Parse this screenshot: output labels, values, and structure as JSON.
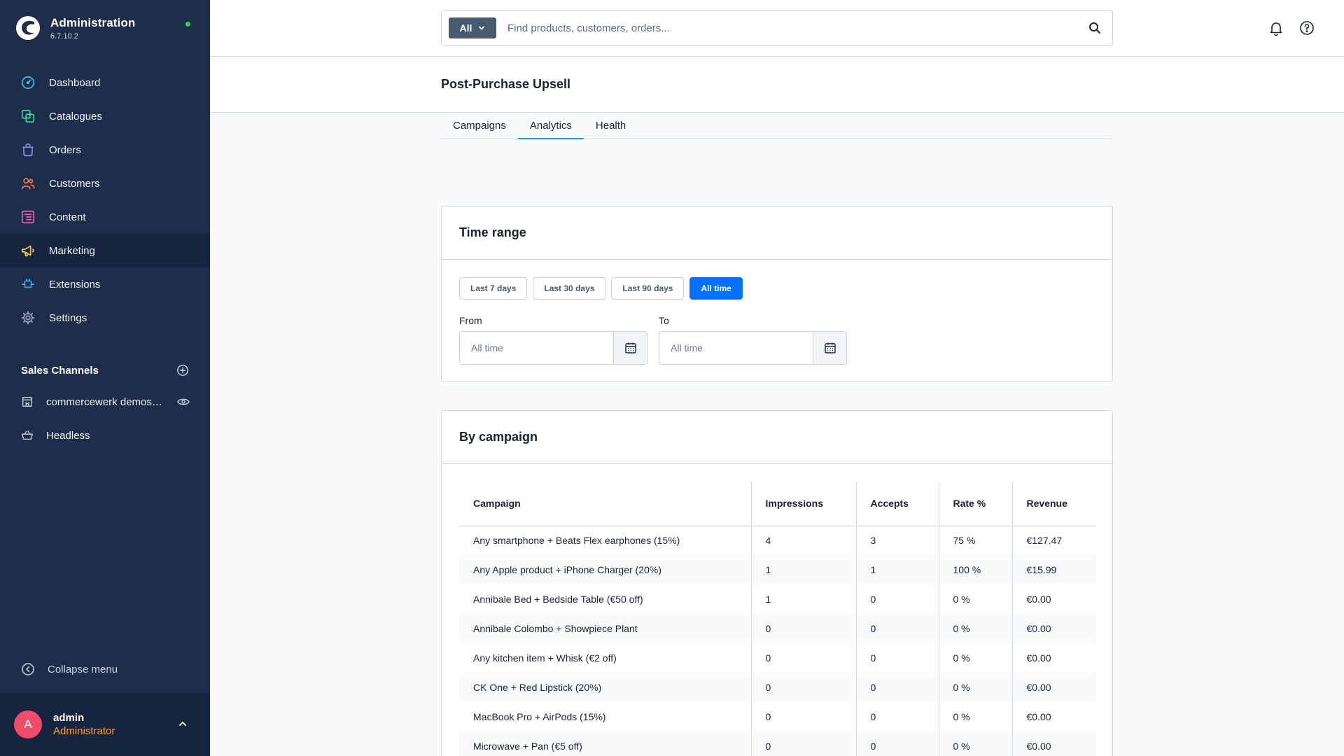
{
  "app": {
    "title": "Administration",
    "version": "6.7.10.2"
  },
  "nav": {
    "items": [
      {
        "label": "Dashboard",
        "icon": "dashboard-icon"
      },
      {
        "label": "Catalogues",
        "icon": "catalogue-icon"
      },
      {
        "label": "Orders",
        "icon": "shopping-bag-icon"
      },
      {
        "label": "Customers",
        "icon": "customers-icon"
      },
      {
        "label": "Content",
        "icon": "content-icon"
      },
      {
        "label": "Marketing",
        "icon": "megaphone-icon"
      },
      {
        "label": "Extensions",
        "icon": "plug-icon"
      },
      {
        "label": "Settings",
        "icon": "gear-icon"
      }
    ],
    "active": "Marketing"
  },
  "sales_channels": {
    "title": "Sales Channels",
    "items": [
      {
        "label": "commercewerk demoshop",
        "icon": "storefront-icon"
      },
      {
        "label": "Headless",
        "icon": "basket-icon"
      }
    ]
  },
  "sidebar_footer": {
    "collapse_label": "Collapse menu",
    "user_initial": "A",
    "user_name": "admin",
    "user_role": "Administrator"
  },
  "search": {
    "type_label": "All",
    "placeholder": "Find products, customers, orders..."
  },
  "page": {
    "title": "Post-Purchase Upsell"
  },
  "tabs": [
    {
      "label": "Campaigns"
    },
    {
      "label": "Analytics"
    },
    {
      "label": "Health"
    }
  ],
  "active_tab": "Analytics",
  "time_range": {
    "title": "Time range",
    "buttons": [
      {
        "label": "Last 7 days"
      },
      {
        "label": "Last 30 days"
      },
      {
        "label": "Last 90 days"
      },
      {
        "label": "All time"
      }
    ],
    "active_button": "All time",
    "from_label": "From",
    "from_placeholder": "All time",
    "to_label": "To",
    "to_placeholder": "All time"
  },
  "by_campaign": {
    "title": "By campaign",
    "columns": [
      "Campaign",
      "Impressions",
      "Accepts",
      "Rate %",
      "Revenue"
    ],
    "rows": [
      [
        "Any smartphone + Beats Flex earphones (15%)",
        "4",
        "3",
        "75 %",
        "€127.47"
      ],
      [
        "Any Apple product + iPhone Charger (20%)",
        "1",
        "1",
        "100 %",
        "€15.99"
      ],
      [
        "Annibale Bed + Bedside Table (€50 off)",
        "1",
        "0",
        "0 %",
        "€0.00"
      ],
      [
        "Annibale Colombo + Showpiece Plant",
        "0",
        "0",
        "0 %",
        "€0.00"
      ],
      [
        "Any kitchen item + Whisk (€2 off)",
        "0",
        "0",
        "0 %",
        "€0.00"
      ],
      [
        "CK One + Red Lipstick (20%)",
        "0",
        "0",
        "0 %",
        "€0.00"
      ],
      [
        "MacBook Pro + AirPods (15%)",
        "0",
        "0",
        "0 %",
        "€0.00"
      ],
      [
        "Microwave + Pan (€5 off)",
        "0",
        "0",
        "0 %",
        "€0.00"
      ]
    ]
  },
  "colors": {
    "sidebar": "#1e2e4a",
    "sidebar_active": "#172541",
    "accent": "#0870ff",
    "tab_underline": "#189eff",
    "role": "#ffa128",
    "avatar": "#ef4b6a",
    "status": "#37d046"
  }
}
